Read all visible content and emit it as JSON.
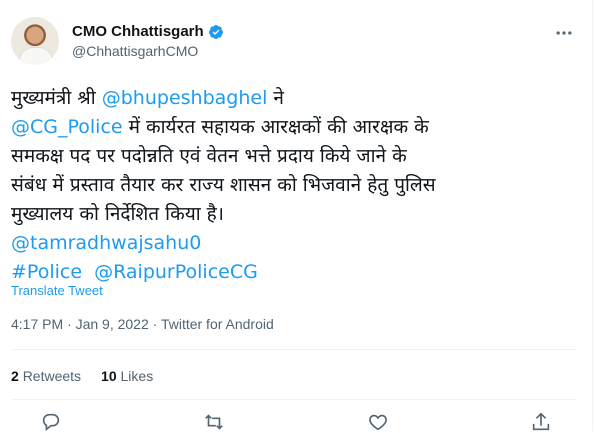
{
  "author": {
    "display_name": "CMO Chhattisgarh",
    "handle": "@ChhattisgarhCMO"
  },
  "tweet": {
    "line1_prefix": "मुख्यमंत्री श्री ",
    "mention1": "@bhupeshbaghel",
    "line1_suffix": " ने",
    "mention2": "@CG_Police",
    "line2_rest": " में कार्यरत सहायक आरक्षकों की आरक्षक के",
    "line3": "समकक्ष पद पर पदोन्नति एवं वेतन भत्ते प्रदाय किये जाने के",
    "line4": "संबंध में प्रस्ताव तैयार कर राज्य शासन को भिजवाने हेतु पुलिस",
    "line5": "मुख्यालय को निर्देशित किया है।",
    "mention3": "@tamradhwajsahu0",
    "hashtag": "#Police",
    "mention4": "@RaipurPoliceCG"
  },
  "translate_label": "Translate Tweet",
  "meta": "4:17 PM · Jan 9, 2022 · Twitter for Android",
  "stats": {
    "retweets_count": "2",
    "retweets_label": "Retweets",
    "likes_count": "10",
    "likes_label": "Likes"
  },
  "colors": {
    "link": "#1d9bf0",
    "secondary_text": "#536471",
    "divider": "#eff3f4"
  }
}
